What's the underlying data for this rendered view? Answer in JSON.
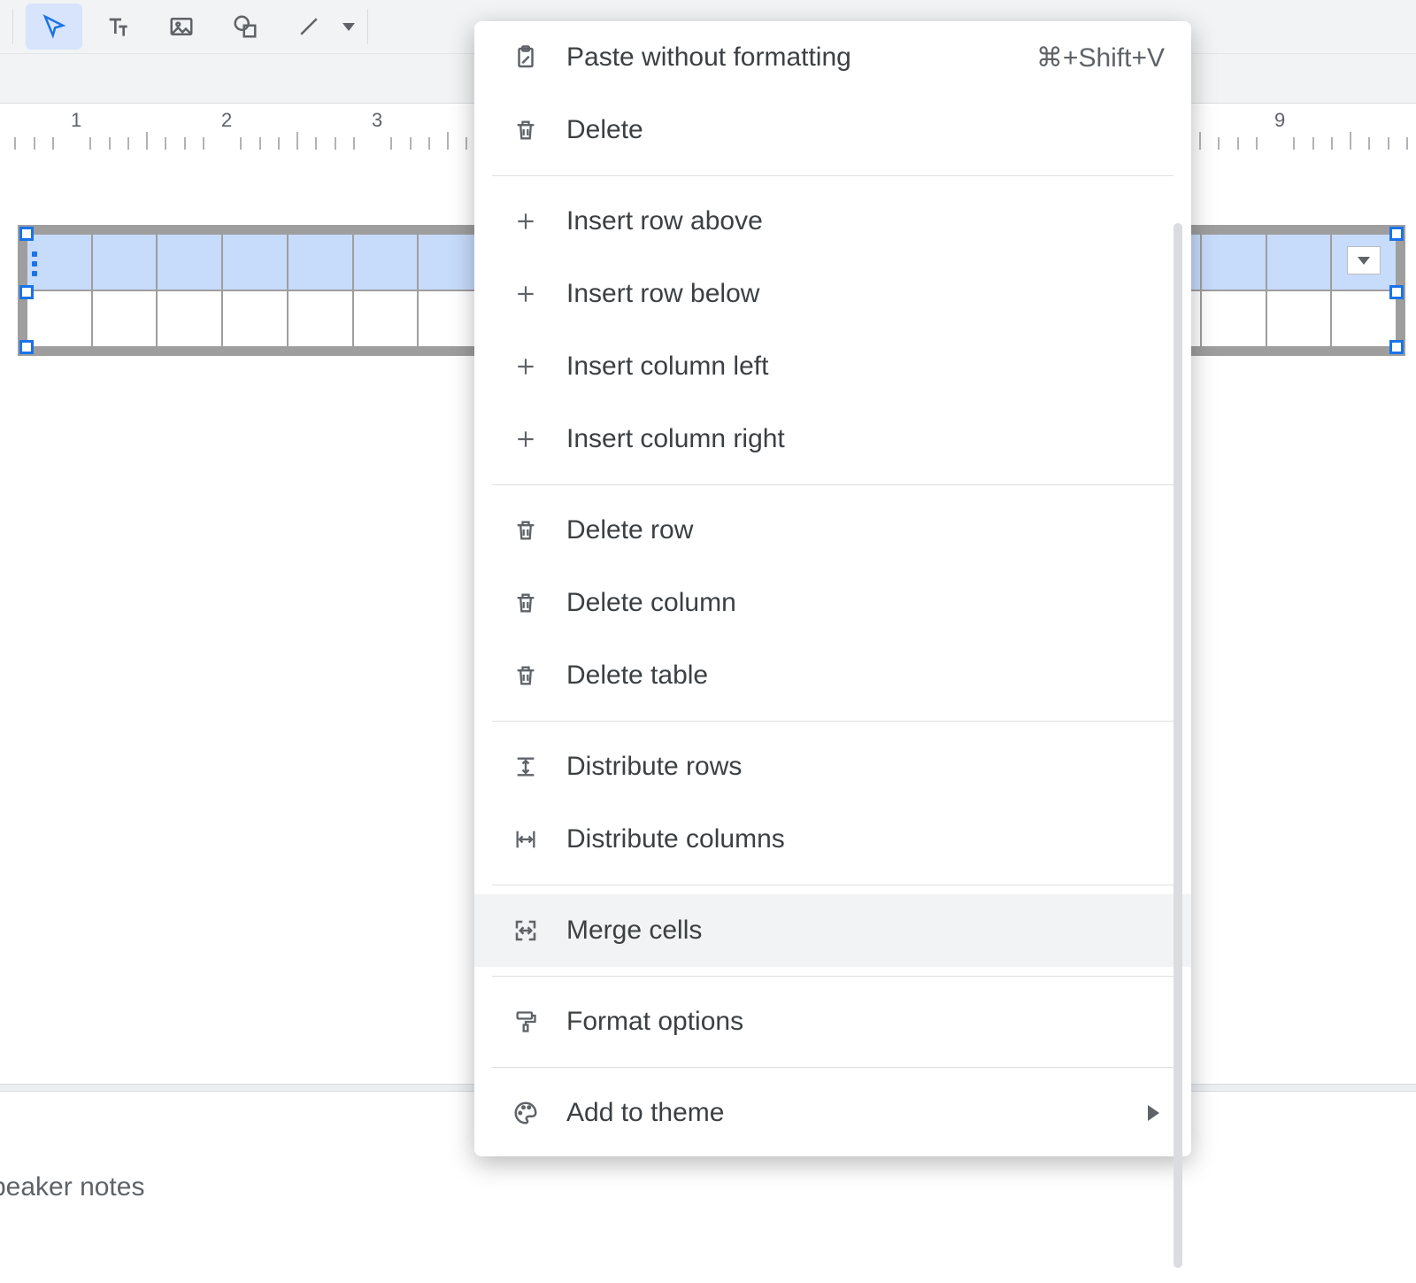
{
  "ruler": {
    "labels": [
      "1",
      "2",
      "3",
      "9"
    ]
  },
  "speaker_notes_placeholder": "peaker notes",
  "context_menu": {
    "paste_without_formatting": "Paste without formatting",
    "paste_shortcut": "⌘+Shift+V",
    "delete": "Delete",
    "insert_row_above": "Insert row above",
    "insert_row_below": "Insert row below",
    "insert_column_left": "Insert column left",
    "insert_column_right": "Insert column right",
    "delete_row": "Delete row",
    "delete_column": "Delete column",
    "delete_table": "Delete table",
    "distribute_rows": "Distribute rows",
    "distribute_columns": "Distribute columns",
    "merge_cells": "Merge cells",
    "format_options": "Format options",
    "add_to_theme": "Add to theme"
  }
}
